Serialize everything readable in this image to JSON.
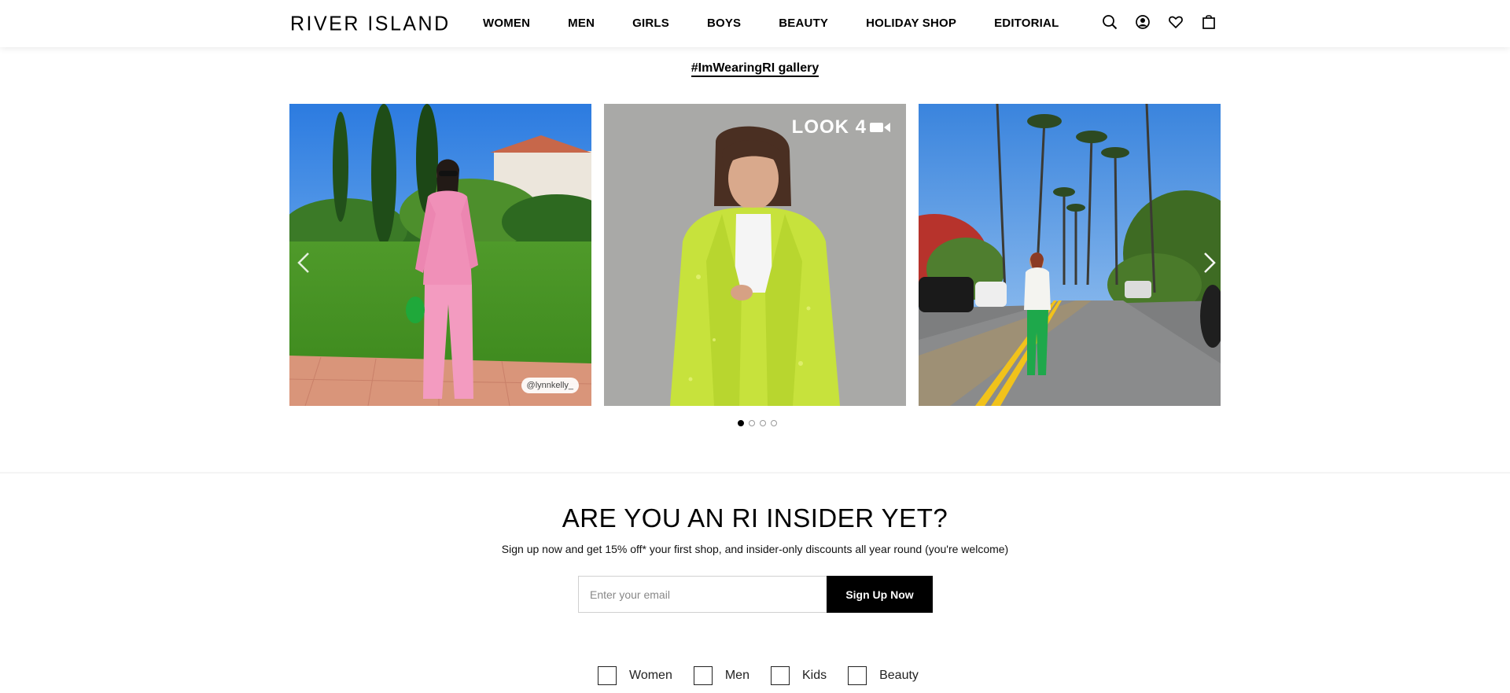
{
  "brand": {
    "name": "RIVER ISLAND"
  },
  "nav": {
    "items": [
      "WOMEN",
      "MEN",
      "GIRLS",
      "BOYS",
      "BEAUTY",
      "HOLIDAY SHOP",
      "EDITORIAL"
    ]
  },
  "header_icons": [
    "search-icon",
    "account-icon",
    "wishlist-heart-icon",
    "shopping-bag-icon"
  ],
  "gallery": {
    "link_label": "#ImWearingRI gallery",
    "tiles": [
      {
        "handle": "@lynnkelly_"
      },
      {
        "badge": "LOOK 4"
      },
      {}
    ],
    "dots_total": 4,
    "dots_active_index": 0
  },
  "newsletter": {
    "title": "ARE YOU AN RI INSIDER YET?",
    "subtitle": "Sign up now and get 15% off* your first shop, and insider-only discounts all year round (you're welcome)",
    "email_placeholder": "Enter your email",
    "submit_label": "Sign Up Now",
    "preferences": [
      "Women",
      "Men",
      "Kids",
      "Beauty"
    ]
  }
}
